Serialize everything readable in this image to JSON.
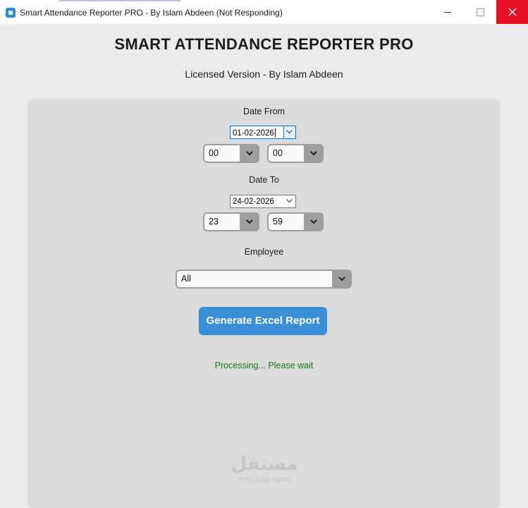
{
  "window": {
    "title": "Smart Attendance Reporter PRO - By Islam Abdeen (Not Responding)",
    "icons": {
      "app": "app-icon",
      "minimize": "minimize-icon",
      "maximize": "maximize-icon",
      "close": "close-icon"
    },
    "close_color": "#e81123"
  },
  "header": {
    "title": "SMART ATTENDANCE REPORTER PRO",
    "subtitle": "Licensed Version - By Islam Abdeen"
  },
  "form": {
    "date_from": {
      "label": "Date From",
      "date": "01-02-2026",
      "hour": "00",
      "minute": "00"
    },
    "date_to": {
      "label": "Date To",
      "date": "24-02-2026",
      "hour": "23",
      "minute": "59"
    },
    "employee": {
      "label": "Employee",
      "value": "All"
    },
    "generate_button": "Generate Excel Report",
    "status": "Processing... Please wait"
  },
  "colors": {
    "button": "#3a8fd9",
    "status": "#1a7a1a"
  },
  "watermark": {
    "arabic": "مستقل",
    "latin": "mostaql.com"
  }
}
